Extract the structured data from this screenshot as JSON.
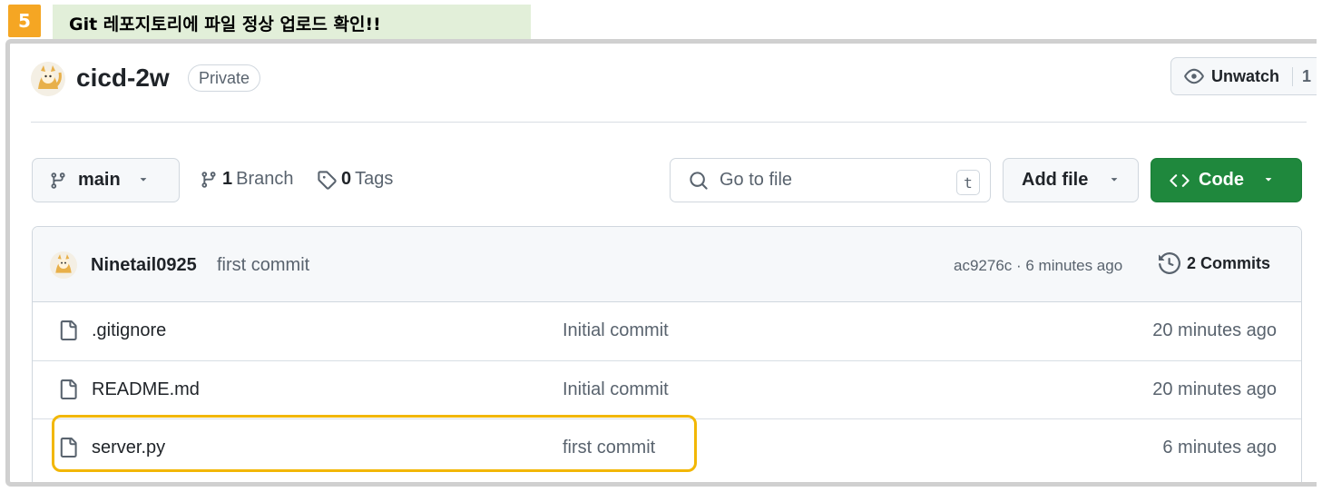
{
  "annotation": {
    "step_number": "5",
    "title": "Git 레포지토리에 파일 정상 업로드 확인!!",
    "highlight_color": "#f2b705"
  },
  "repo": {
    "name": "cicd-2w",
    "visibility": "Private",
    "unwatch_label": "Unwatch",
    "watch_count": "1"
  },
  "toolbar": {
    "branch_name": "main",
    "branch_count": "1",
    "branch_label": "Branch",
    "tag_count": "0",
    "tag_label": "Tags",
    "search_placeholder": "Go to file",
    "search_shortcut": "t",
    "add_file_label": "Add file",
    "code_label": "Code",
    "code_color": "#1f883d"
  },
  "latest_commit": {
    "author": "Ninetail0925",
    "message": "first commit",
    "meta": "ac9276c · 6 minutes ago",
    "commits_label": "2 Commits"
  },
  "files": [
    {
      "name": ".gitignore",
      "message": "Initial commit",
      "date": "20 minutes ago",
      "icon": "file-icon"
    },
    {
      "name": "README.md",
      "message": "Initial commit",
      "date": "20 minutes ago",
      "icon": "file-icon"
    },
    {
      "name": "server.py",
      "message": "first commit",
      "date": "6 minutes ago",
      "icon": "file-icon"
    }
  ]
}
